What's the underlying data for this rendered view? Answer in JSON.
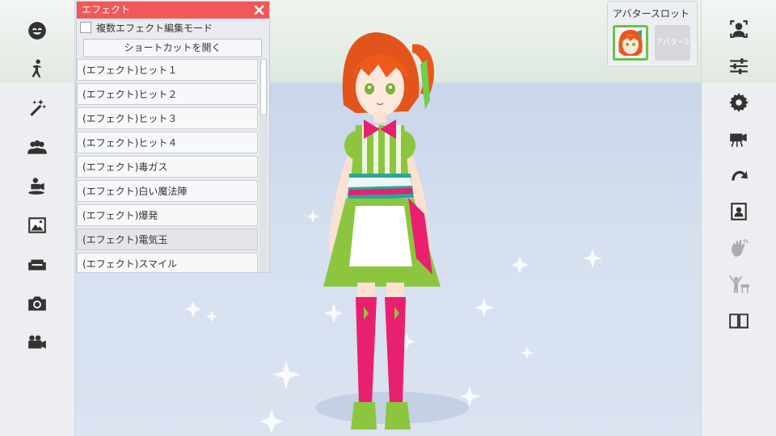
{
  "effect_panel": {
    "title": "エフェクト",
    "multi_edit_label": "複数エフェクト編集モード",
    "multi_edit_checked": false,
    "shortcut_button": "ショートカットを開く",
    "items": [
      "(エフェクト)ヒット１",
      "(エフェクト)ヒット２",
      "(エフェクト)ヒット３",
      "(エフェクト)ヒット４",
      "(エフェクト)毒ガス",
      "(エフェクト)白い魔法陣",
      "(エフェクト)爆発",
      "(エフェクト)電気玉",
      "(エフェクト)スマイル"
    ]
  },
  "avatar_slots": {
    "title": "アバタースロット",
    "slot2_label": "アバター2"
  },
  "left_sidebar": {
    "icons": [
      "face-icon",
      "pose-icon",
      "magic-wand-icon",
      "group-icon",
      "camera-stage-icon",
      "image-icon",
      "sofa-icon",
      "camera-icon",
      "video-camera-icon"
    ]
  },
  "right_sidebar": {
    "icons": [
      "person-frame-icon",
      "sliders-icon",
      "gear-icon",
      "movie-camera-icon",
      "redo-icon",
      "portrait-icon",
      "wave-hand-icon",
      "cheer-icon",
      "book-icon"
    ]
  },
  "colors": {
    "header": "#f0585a",
    "slot_active": "#6cc04a",
    "character_hair": "#ee5a1c",
    "character_dress": "#8cc63f",
    "character_stockings": "#e8206f"
  }
}
